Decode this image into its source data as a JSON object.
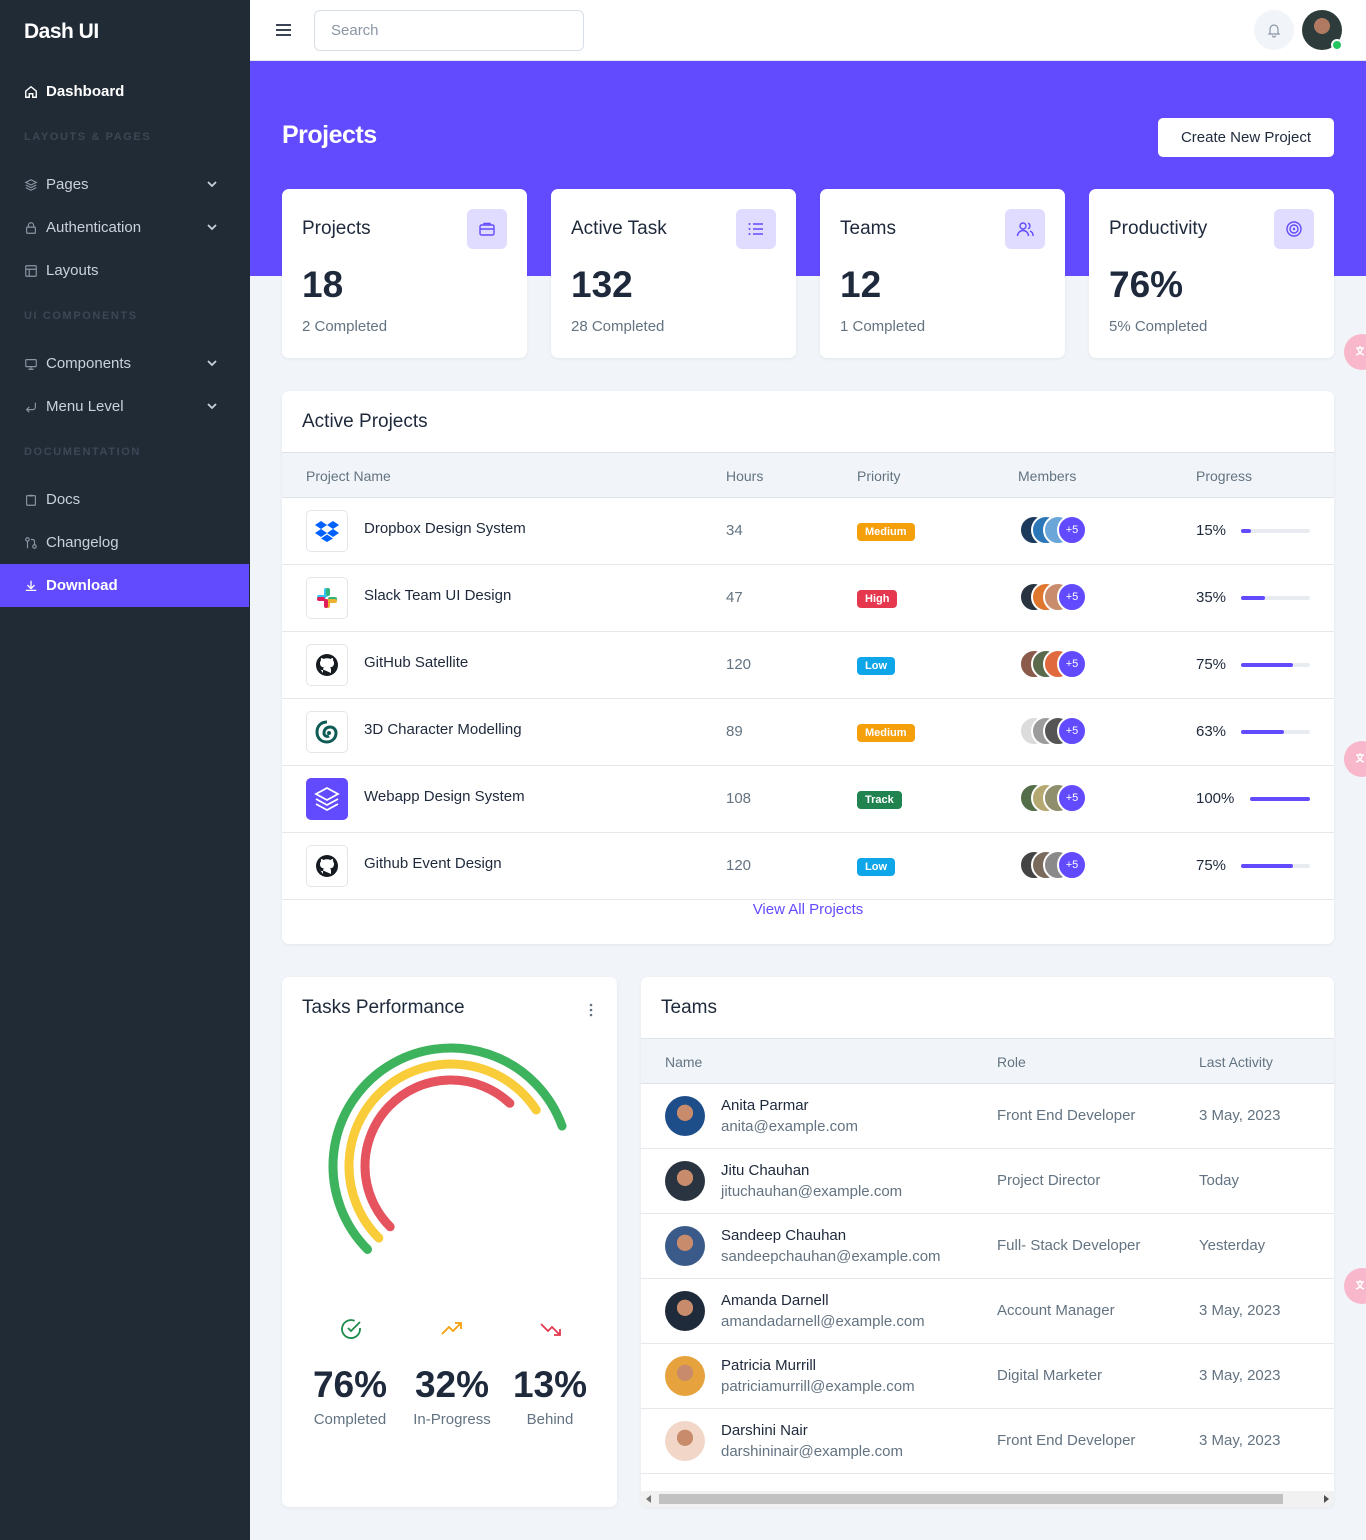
{
  "brand": "Dash UI",
  "colors": {
    "primary": "#624bff",
    "sidebar": "#212b36",
    "medium": "#f59f0a",
    "high": "#e5384f",
    "low": "#0ea5e9",
    "track": "#218350"
  },
  "sidebar": {
    "dashboard": "Dashboard",
    "heading_layouts": "Layouts & Pages",
    "pages": "Pages",
    "authentication": "Authentication",
    "layouts": "Layouts",
    "heading_ui": "UI Components",
    "components": "Components",
    "menu_level": "Menu Level",
    "heading_docs": "Documentation",
    "docs": "Docs",
    "changelog": "Changelog",
    "download": "Download"
  },
  "topbar": {
    "search_placeholder": "Search"
  },
  "hero": {
    "title": "Projects",
    "create_button": "Create New Project"
  },
  "stats": [
    {
      "label": "Projects",
      "value": "18",
      "sub": "2 Completed",
      "icon": "briefcase-icon"
    },
    {
      "label": "Active Task",
      "value": "132",
      "sub": "28 Completed",
      "icon": "list-icon"
    },
    {
      "label": "Teams",
      "value": "12",
      "sub": "1 Completed",
      "icon": "people-icon"
    },
    {
      "label": "Productivity",
      "value": "76%",
      "sub": "5% Completed",
      "icon": "target-icon"
    }
  ],
  "active_projects": {
    "title": "Active Projects",
    "columns": {
      "name": "Project Name",
      "hours": "Hours",
      "priority": "Priority",
      "members": "Members",
      "progress": "Progress"
    },
    "rows": [
      {
        "name": "Dropbox Design System",
        "hours": "34",
        "priority": "Medium",
        "extra": "+5",
        "progress": "15%",
        "progress_value": 0.15,
        "logo": "dropbox-icon"
      },
      {
        "name": "Slack Team UI Design",
        "hours": "47",
        "priority": "High",
        "extra": "+5",
        "progress": "35%",
        "progress_value": 0.35,
        "logo": "slack-icon"
      },
      {
        "name": "GitHub Satellite",
        "hours": "120",
        "priority": "Low",
        "extra": "+5",
        "progress": "75%",
        "progress_value": 0.75,
        "logo": "github-icon"
      },
      {
        "name": "3D Character Modelling",
        "hours": "89",
        "priority": "Medium",
        "extra": "+5",
        "progress": "63%",
        "progress_value": 0.63,
        "logo": "3d-icon"
      },
      {
        "name": "Webapp Design System",
        "hours": "108",
        "priority": "Track",
        "extra": "+5",
        "progress": "100%",
        "progress_value": 1.0,
        "logo": "layers-icon"
      },
      {
        "name": "Github Event Design",
        "hours": "120",
        "priority": "Low",
        "extra": "+5",
        "progress": "75%",
        "progress_value": 0.75,
        "logo": "github-icon"
      }
    ],
    "view_all": "View All Projects"
  },
  "tasks_performance": {
    "title": "Tasks Performance",
    "items": [
      {
        "value": "76%",
        "label": "Completed",
        "icon": "check-circle-icon"
      },
      {
        "value": "32%",
        "label": "In-Progress",
        "icon": "trending-up-icon"
      },
      {
        "value": "13%",
        "label": "Behind",
        "icon": "trending-down-icon"
      }
    ]
  },
  "teams": {
    "title": "Teams",
    "columns": {
      "name": "Name",
      "role": "Role",
      "activity": "Last Activity"
    },
    "rows": [
      {
        "name": "Anita Parmar",
        "email": "anita@example.com",
        "role": "Front End Developer",
        "activity": "3 May, 2023"
      },
      {
        "name": "Jitu Chauhan",
        "email": "jituchauhan@example.com",
        "role": "Project Director",
        "activity": "Today"
      },
      {
        "name": "Sandeep Chauhan",
        "email": "sandeepchauhan@example.com",
        "role": "Full- Stack Developer",
        "activity": "Yesterday"
      },
      {
        "name": "Amanda Darnell",
        "email": "amandadarnell@example.com",
        "role": "Account Manager",
        "activity": "3 May, 2023"
      },
      {
        "name": "Patricia Murrill",
        "email": "patriciamurrill@example.com",
        "role": "Digital Marketer",
        "activity": "3 May, 2023"
      },
      {
        "name": "Darshini Nair",
        "email": "darshininair@example.com",
        "role": "Front End Developer",
        "activity": "3 May, 2023"
      }
    ]
  }
}
